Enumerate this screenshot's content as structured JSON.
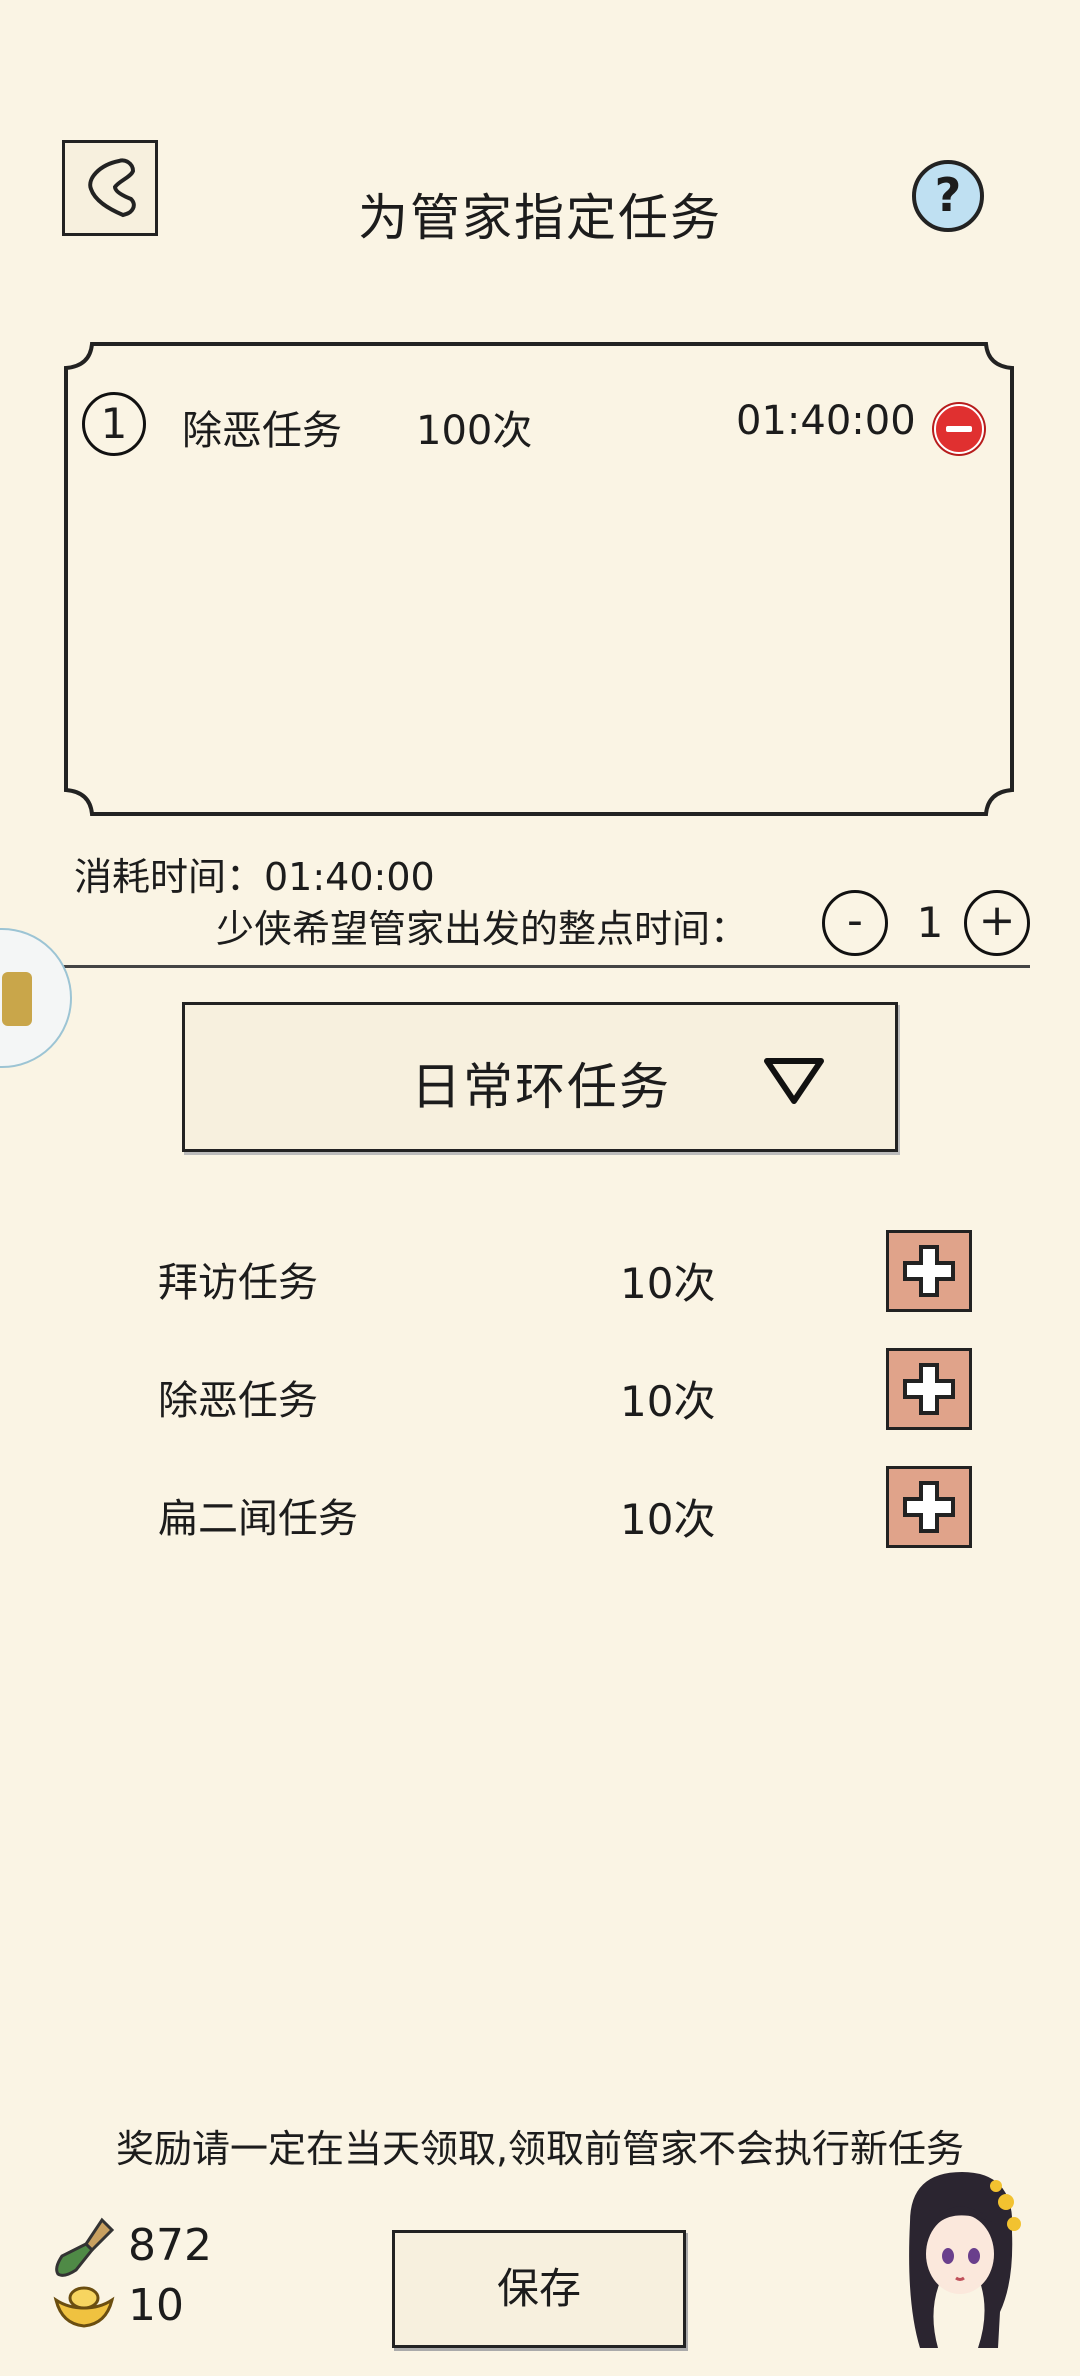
{
  "header": {
    "title": "为管家指定任务",
    "help_label": "?"
  },
  "selected_tasks": [
    {
      "index": "1",
      "name": "除恶任务",
      "count": "100次",
      "time": "01:40:00"
    }
  ],
  "consume": {
    "label": "消耗时间：01:40:00"
  },
  "departure": {
    "label": "少侠希望管家出发的整点时间：",
    "minus": "-",
    "value": "1",
    "plus": "+"
  },
  "dropdown": {
    "label": "日常环任务"
  },
  "task_list": [
    {
      "name": "拜访任务",
      "count": "10次"
    },
    {
      "name": "除恶任务",
      "count": "10次"
    },
    {
      "name": "扁二闻任务",
      "count": "10次"
    }
  ],
  "footer": {
    "notice": "奖励请一定在当天领取,领取前管家不会执行新任务",
    "shovel_count": "872",
    "gold_count": "10",
    "save_label": "保存"
  },
  "colors": {
    "background": "#faf4e4",
    "add_button": "#e0a38a",
    "remove_button": "#e03030",
    "help_button": "#bfe0f2"
  }
}
